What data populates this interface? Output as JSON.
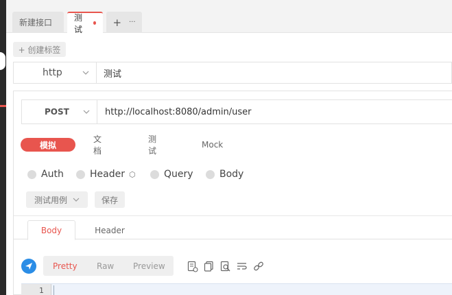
{
  "tabs": [
    {
      "label": "新建接口"
    },
    {
      "label": "测试",
      "unsaved": true
    },
    {
      "add_symbol": "+",
      "more_symbol": "···"
    }
  ],
  "tag_button": {
    "label": "+ 创建标签"
  },
  "protocol": {
    "value": "http",
    "name": "测试"
  },
  "request": {
    "method": "POST",
    "url": "http://localhost:8080/admin/user"
  },
  "modes": [
    "模拟",
    "文档",
    "测试",
    "Mock"
  ],
  "param_types": [
    "Auth",
    "Header",
    "Query",
    "Body"
  ],
  "actions": {
    "test_case": "测试用例",
    "save": "保存"
  },
  "sub_tabs": [
    "Body",
    "Header"
  ],
  "view_modes": [
    "Pretty",
    "Raw",
    "Preview"
  ],
  "editor": {
    "line_number": "1"
  },
  "colors": {
    "accent": "#e8554e",
    "send": "#2b8de6"
  }
}
